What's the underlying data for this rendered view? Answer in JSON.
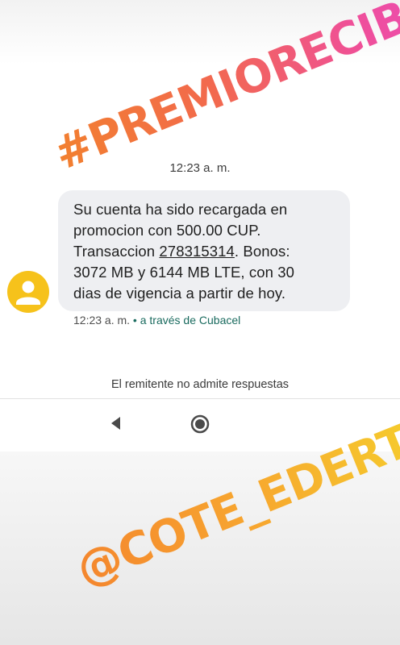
{
  "message": {
    "header_time": "12:23 a. m.",
    "body_line_1": "Su cuenta ha sido recargada en",
    "body_line_2": "promocion con 500.00 CUP.",
    "body_line_3_prefix": "Transaccion ",
    "transaction_id": "278315314",
    "body_line_3_suffix": ". Bonos:",
    "body_line_4": "3072 MB y 6144 MB LTE, con 30",
    "body_line_5": "dias de vigencia a partir de hoy.",
    "sent_time": "12:23 a. m.",
    "via_separator": " • ",
    "via_label": "a través de Cubacel"
  },
  "footer": {
    "no_reply_notice": "El remitente no admite respuestas"
  },
  "nav": {
    "back_icon": "back-triangle-icon",
    "home_icon": "home-circle-icon"
  },
  "stickers": {
    "top_text": "#PREMIORECIBIDO",
    "bottom_text": "@COTE_EDERTU"
  },
  "colors": {
    "avatar": "#f6c21b",
    "bubble": "#eeeff2",
    "via_link": "#1a6b5f"
  }
}
